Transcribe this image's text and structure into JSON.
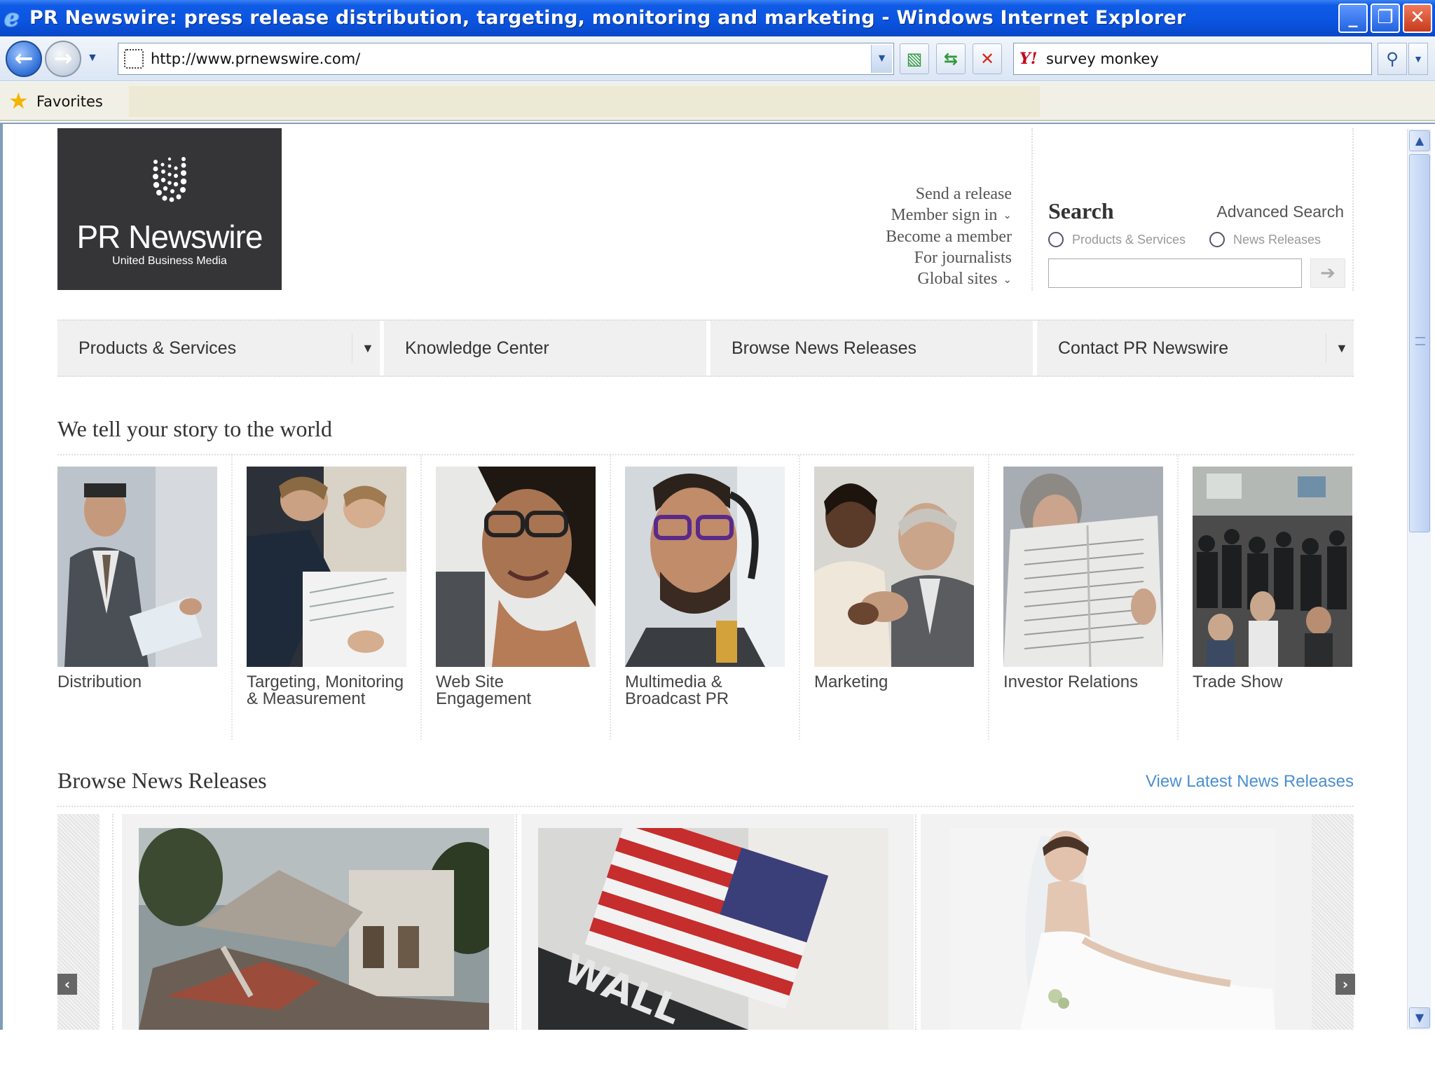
{
  "browser": {
    "title": "PR Newswire: press release distribution, targeting, monitoring and marketing - Windows Internet Explorer",
    "address": "http://www.prnewswire.com/",
    "search_query": "survey monkey",
    "favorites_label": "Favorites",
    "buttons": {
      "minimize": "_",
      "restore": "❐",
      "close": "✕",
      "back": "←",
      "forward": "→"
    }
  },
  "site": {
    "logo": {
      "name": "PR Newswire",
      "subtitle": "United Business Media"
    },
    "utility_links": [
      "Send a release",
      "Member sign in",
      "Become a member",
      "For journalists",
      "Global sites"
    ],
    "search": {
      "heading": "Search",
      "advanced": "Advanced Search",
      "options": [
        "Products & Services",
        "News Releases"
      ]
    },
    "nav": [
      "Products & Services",
      "Knowledge Center",
      "Browse News Releases",
      "Contact PR Newswire"
    ],
    "tagline": "We tell your story to the world",
    "services": [
      "Distribution",
      "Targeting, Monitoring & Measurement",
      "Web Site Engagement",
      "Multimedia & Broadcast PR",
      "Marketing",
      "Investor Relations",
      "Trade Show"
    ],
    "browse": {
      "heading": "Browse News Releases",
      "view_latest": "View Latest News Releases"
    }
  },
  "colors": {
    "accent_link": "#4a8fd0",
    "logo_bg": "#353537",
    "ie_titlebar": "#0a54e0"
  }
}
